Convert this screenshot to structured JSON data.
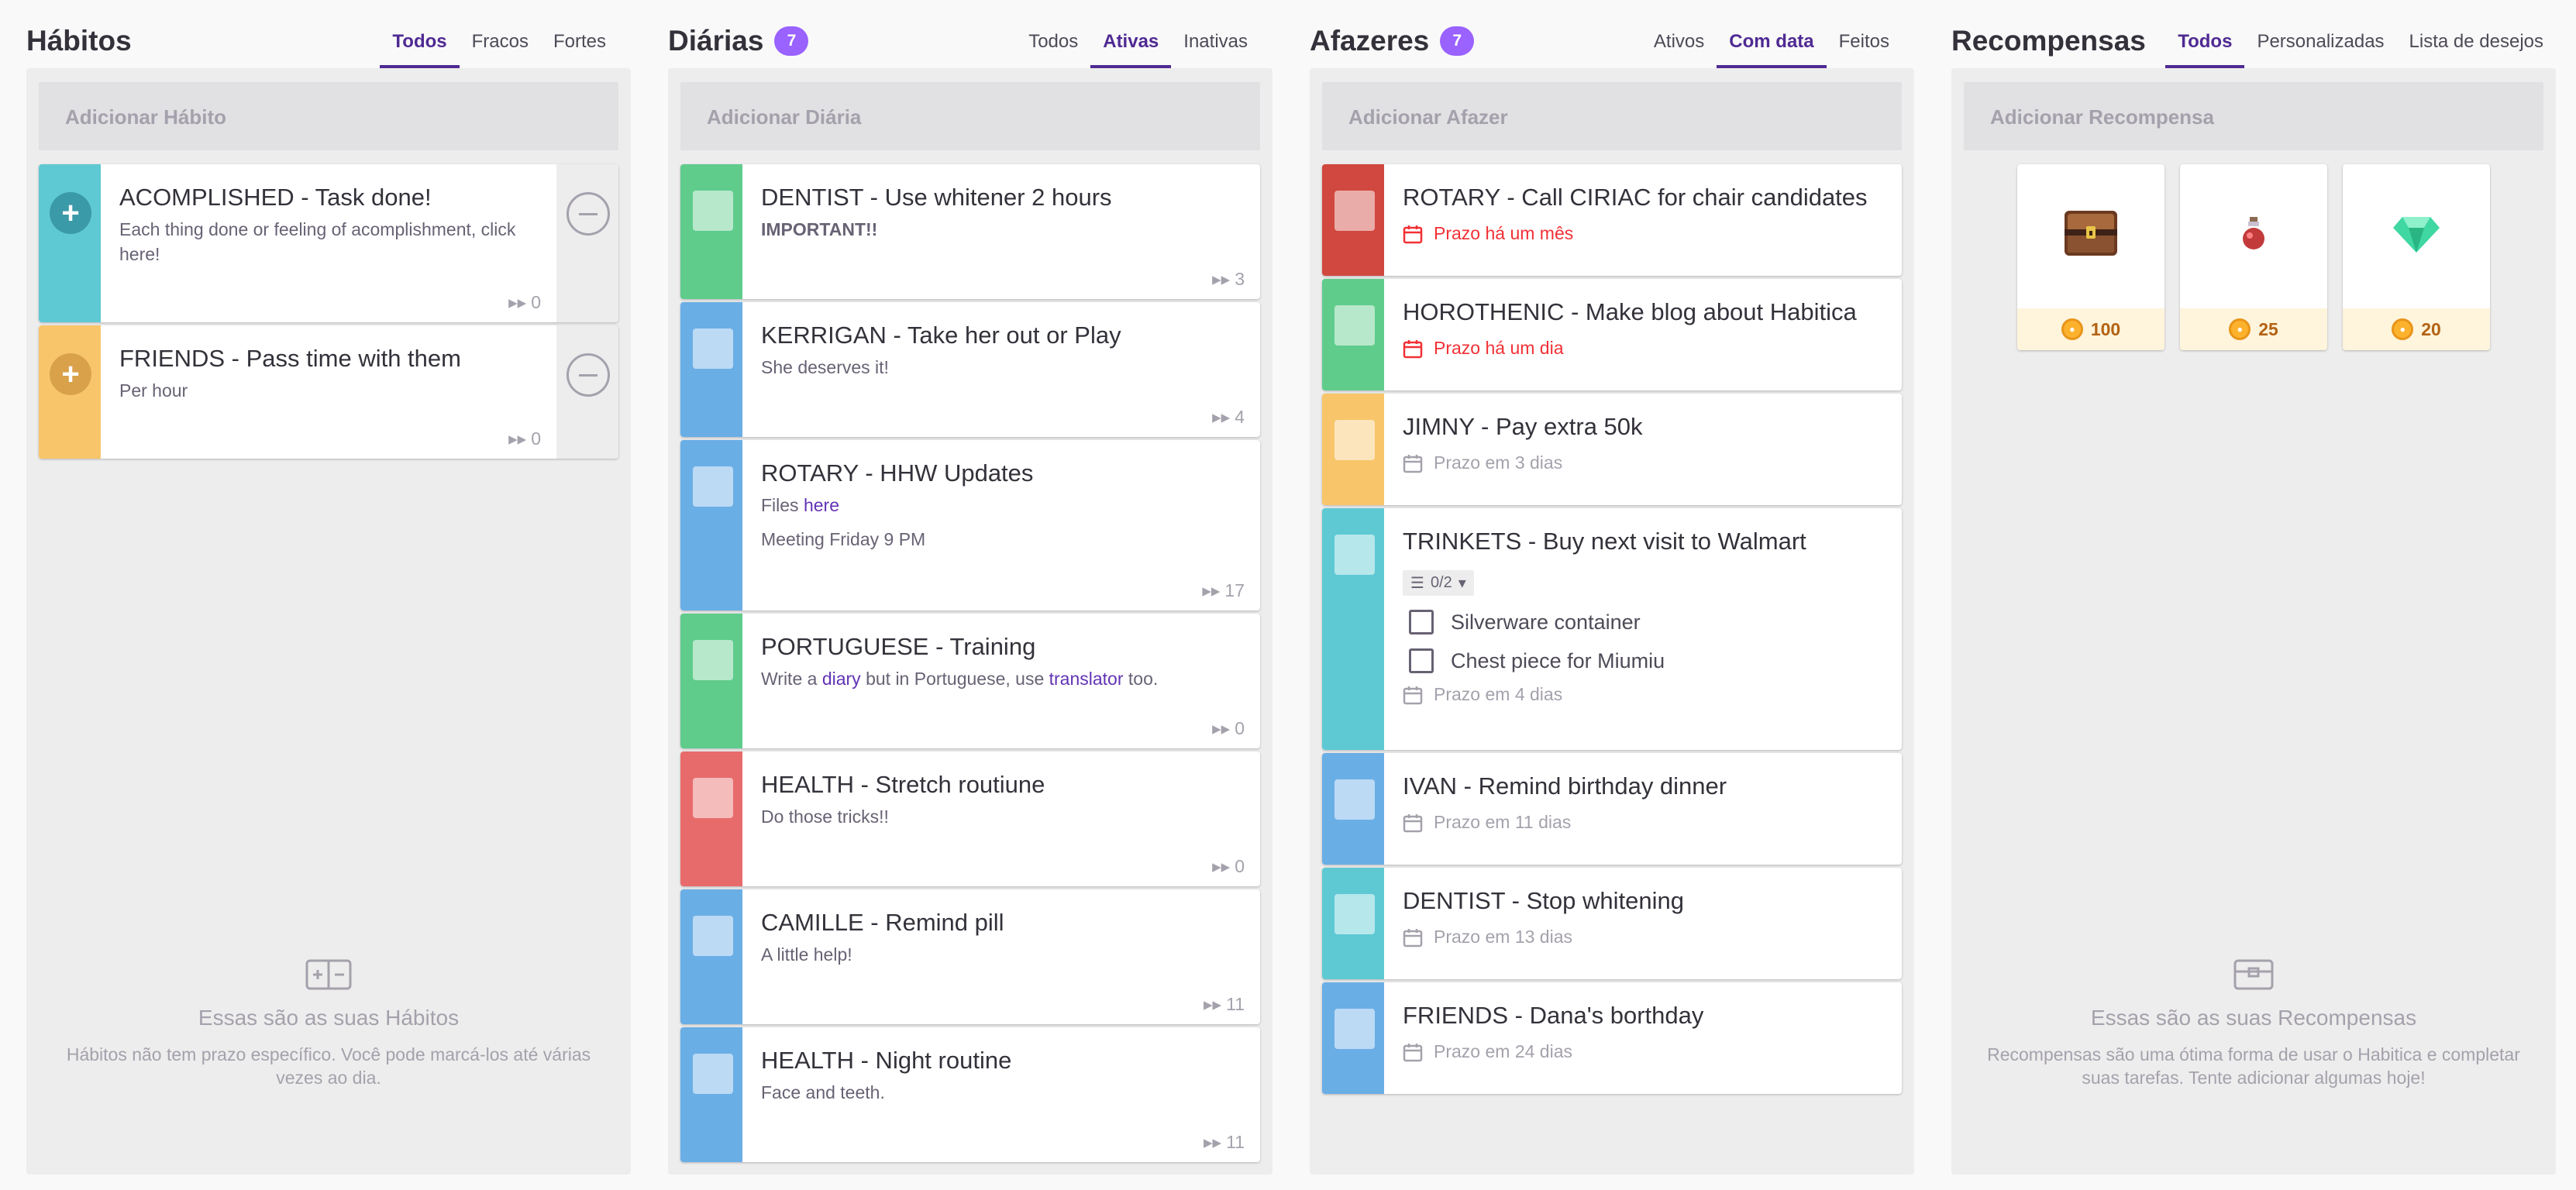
{
  "colors": {
    "teal": "#5ec9d3",
    "teal_dark": "#3b9aa8",
    "orange": "#f8c56a",
    "orange_dark": "#d9a14a",
    "green": "#5fcc8c",
    "blue": "#6aaee6",
    "red": "#e86b6b",
    "dark_red": "#d0483f",
    "purple": "#4f2a93",
    "badge": "#9a62ff"
  },
  "habits": {
    "title": "Hábitos",
    "tabs": [
      "Todos",
      "Fracos",
      "Fortes"
    ],
    "active_tab": "Todos",
    "add_placeholder": "Adicionar Hábito",
    "items": [
      {
        "title": "ACOMPLISHED - Task done!",
        "notes": "Each thing done or feeling of acomplishment, click here!",
        "streak": "0",
        "color": "teal"
      },
      {
        "title": "FRIENDS - Pass time with them",
        "notes": "Per hour",
        "streak": "0",
        "color": "orange"
      }
    ],
    "empty_title": "Essas são as suas Hábitos",
    "empty_desc": "Hábitos não tem prazo específico. Você pode marcá-los até várias vezes ao dia."
  },
  "dailies": {
    "title": "Diárias",
    "count": "7",
    "tabs": [
      "Todos",
      "Ativas",
      "Inativas"
    ],
    "active_tab": "Ativas",
    "add_placeholder": "Adicionar Diária",
    "items": [
      {
        "title": "DENTIST - Use whitener 2 hours",
        "notes": "IMPORTANT!!",
        "streak": "3",
        "color": "green"
      },
      {
        "title": "KERRIGAN - Take her out or Play",
        "notes": "She deserves it!",
        "streak": "4",
        "color": "blue"
      },
      {
        "title": "ROTARY - HHW Updates",
        "notes_prefix": "Files ",
        "notes_link": "here",
        "notes2": "Meeting Friday 9 PM",
        "streak": "17",
        "color": "blue"
      },
      {
        "title": "PORTUGUESE - Training",
        "notes_a": "Write a ",
        "notes_link1": "diary",
        "notes_b": " but in Portuguese, use ",
        "notes_link2": "translator",
        "notes_c": " too.",
        "streak": "0",
        "color": "green"
      },
      {
        "title": "HEALTH - Stretch routiune",
        "notes": "Do those tricks!!",
        "streak": "0",
        "color": "red"
      },
      {
        "title": "CAMILLE - Remind pill",
        "notes": "A little help!",
        "streak": "11",
        "color": "blue"
      },
      {
        "title": "HEALTH - Night routine",
        "notes": "Face and teeth.",
        "streak": "11",
        "color": "blue"
      }
    ]
  },
  "todos": {
    "title": "Afazeres",
    "count": "7",
    "tabs": [
      "Ativos",
      "Com data",
      "Feitos"
    ],
    "active_tab": "Com data",
    "add_placeholder": "Adicionar Afazer",
    "items": [
      {
        "title": "ROTARY - Call CIRIAC for chair candidates",
        "due": "Prazo há um mês",
        "overdue": true,
        "color": "dark_red"
      },
      {
        "title": "HOROTHENIC - Make blog about Habitica",
        "due": "Prazo há um dia",
        "overdue": true,
        "color": "green"
      },
      {
        "title": "JIMNY - Pay extra 50k",
        "due": "Prazo em 3 dias",
        "overdue": false,
        "color": "orange"
      },
      {
        "title": "TRINKETS - Buy next visit to Walmart",
        "checklist_count": "0/2",
        "checklist": [
          "Silverware container",
          "Chest piece for Miumiu"
        ],
        "due": "Prazo em 4 dias",
        "overdue": false,
        "color": "teal"
      },
      {
        "title": "IVAN - Remind birthday dinner",
        "due": "Prazo em 11 dias",
        "overdue": false,
        "color": "blue"
      },
      {
        "title": "DENTIST - Stop whitening",
        "due": "Prazo em 13 dias",
        "overdue": false,
        "color": "teal"
      },
      {
        "title": "FRIENDS - Dana's borthday",
        "due": "Prazo em 24 dias",
        "overdue": false,
        "color": "blue"
      }
    ]
  },
  "rewards": {
    "title": "Recompensas",
    "tabs": [
      "Todos",
      "Personalizadas",
      "Lista de desejos"
    ],
    "active_tab": "Todos",
    "add_placeholder": "Adicionar Recompensa",
    "items": [
      {
        "icon": "treasure-chest-icon",
        "price": "100"
      },
      {
        "icon": "health-potion-icon",
        "price": "25"
      },
      {
        "icon": "gem-icon",
        "price": "20"
      }
    ],
    "empty_title": "Essas são as suas Recompensas",
    "empty_desc": "Recompensas são uma ótima forma de usar o Habitica e completar suas tarefas. Tente adicionar algumas hoje!"
  }
}
